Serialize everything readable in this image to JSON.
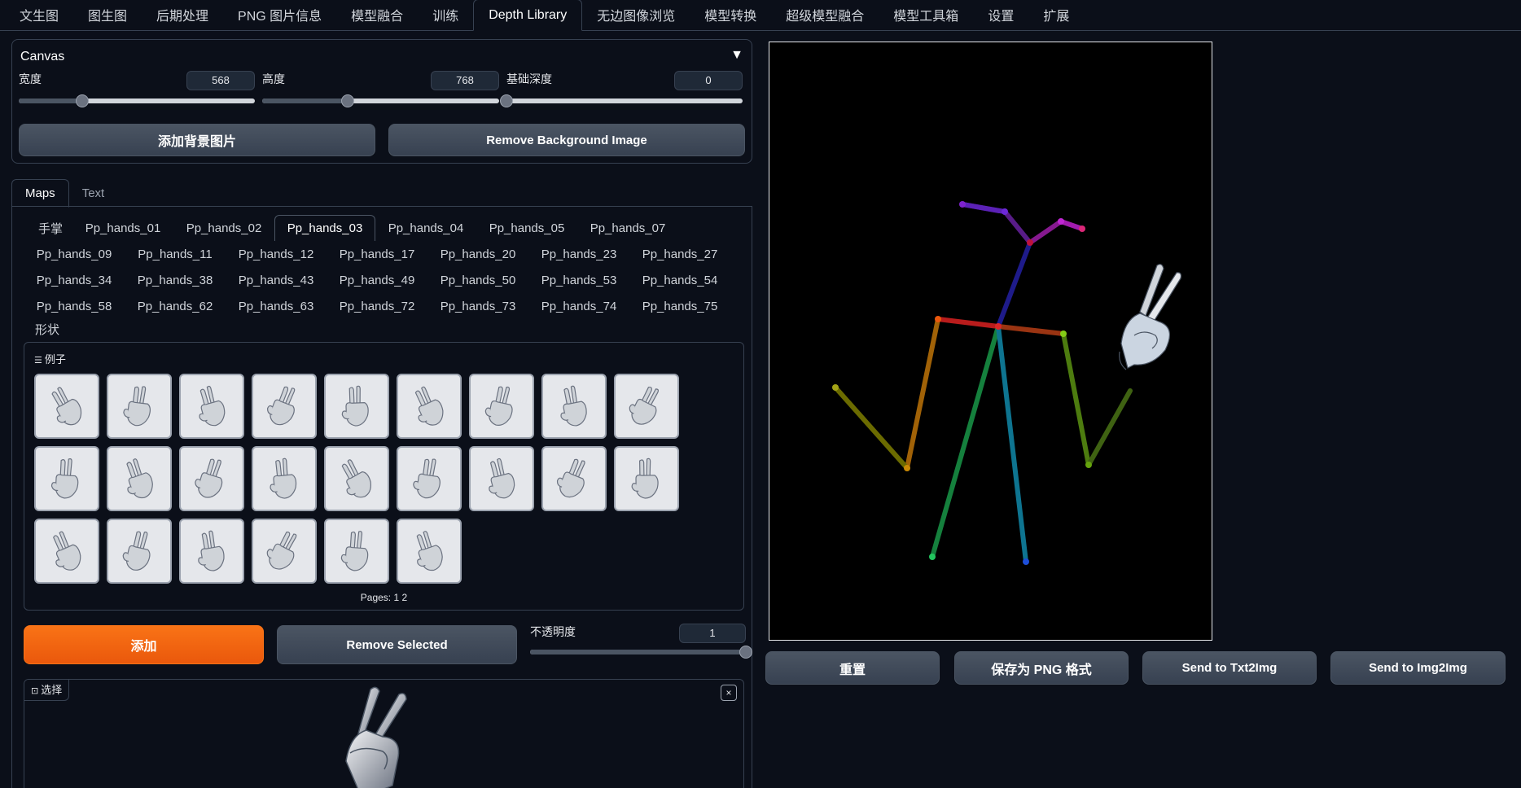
{
  "top_tabs": [
    "文生图",
    "图生图",
    "后期处理",
    "PNG 图片信息",
    "模型融合",
    "训练",
    "Depth Library",
    "无边图像浏览",
    "模型转换",
    "超级模型融合",
    "模型工具箱",
    "设置",
    "扩展"
  ],
  "active_top_tab": "Depth Library",
  "canvas": {
    "title": "Canvas",
    "collapse_icon": "▼",
    "width": {
      "label": "宽度",
      "value": "568",
      "fraction": 0.27
    },
    "height": {
      "label": "高度",
      "value": "768",
      "fraction": 0.36
    },
    "base_depth": {
      "label": "基础深度",
      "value": "0",
      "fraction": 0.0
    },
    "add_bg_button": "添加背景图片",
    "remove_bg_button": "Remove Background Image"
  },
  "sub_tabs": [
    "Maps",
    "Text"
  ],
  "hand_tabs": [
    "手掌",
    "Pp_hands_01",
    "Pp_hands_02",
    "Pp_hands_03",
    "Pp_hands_04",
    "Pp_hands_05",
    "Pp_hands_07",
    "Pp_hands_09",
    "Pp_hands_11",
    "Pp_hands_12",
    "Pp_hands_17",
    "Pp_hands_20",
    "Pp_hands_23",
    "Pp_hands_27",
    "Pp_hands_34",
    "Pp_hands_38",
    "Pp_hands_43",
    "Pp_hands_49",
    "Pp_hands_50",
    "Pp_hands_53",
    "Pp_hands_54",
    "Pp_hands_58",
    "Pp_hands_62",
    "Pp_hands_63",
    "Pp_hands_72",
    "Pp_hands_73",
    "Pp_hands_74",
    "Pp_hands_75"
  ],
  "active_hand_tab": "Pp_hands_03",
  "shape_label": "形状",
  "examples": {
    "label": "例子",
    "icon": "list-icon",
    "count": 24,
    "pages_label": "Pages:",
    "pages": [
      "1",
      "2"
    ]
  },
  "add_button": "添加",
  "remove_selected_button": "Remove Selected",
  "opacity": {
    "label": "不透明度",
    "value": "1",
    "fraction": 1.0
  },
  "select_panel": {
    "label": "选择",
    "icon": "image-icon",
    "close": "×"
  },
  "actions": {
    "reset": "重置",
    "save_png": "保存为 PNG 格式",
    "send_txt2img": "Send to Txt2Img",
    "send_img2img": "Send to Img2Img"
  }
}
